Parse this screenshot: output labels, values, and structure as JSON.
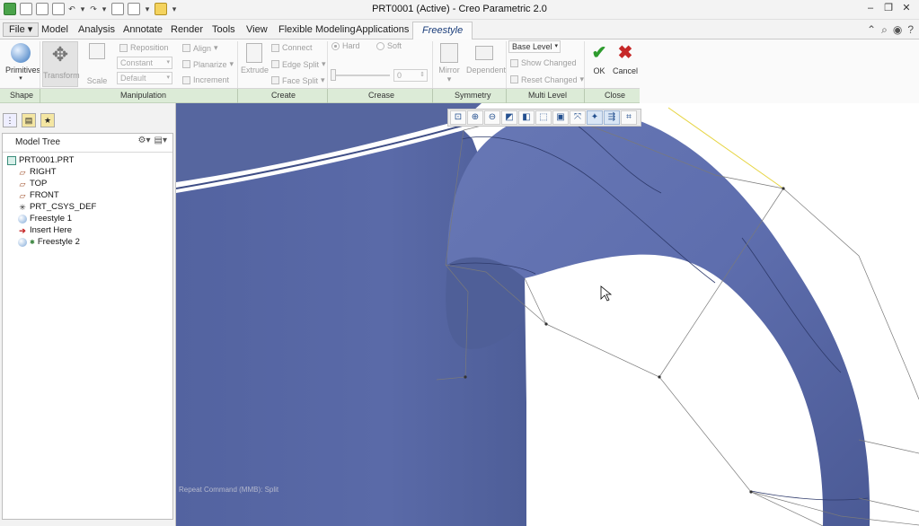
{
  "window": {
    "title": "PRT0001 (Active) - Creo Parametric 2.0",
    "controls": [
      "minimize-icon",
      "restore-icon",
      "close-icon"
    ]
  },
  "quick_access": [
    "app-icon",
    "new-icon",
    "open-icon",
    "save-icon",
    "undo-icon",
    "redo-icon",
    "regenerate-icon",
    "windows-icon",
    "close-window-icon",
    "customize-icon"
  ],
  "menu": {
    "file_label": "File",
    "tabs": [
      "Model",
      "Analysis",
      "Annotate",
      "Render",
      "Tools",
      "View",
      "Flexible Modeling",
      "Applications"
    ],
    "active_tab": "Freestyle"
  },
  "ribbon": {
    "primitives": "Primitives",
    "transform": "Transform",
    "scale": "Scale",
    "reposition": "Reposition",
    "align": "Align",
    "planarize": "Planarize",
    "increment": "Increment",
    "constant": "Constant",
    "default": "Default",
    "extrude": "Extrude",
    "connect": "Connect",
    "edge_split": "Edge Split",
    "face_split": "Face Split",
    "hard": "Hard",
    "soft": "Soft",
    "crease_value": "0",
    "mirror": "Mirror",
    "dependent": "Dependent",
    "base_level": "Base Level",
    "show_changed": "Show Changed",
    "reset_changed": "Reset Changed",
    "ok": "OK",
    "cancel": "Cancel",
    "ok_color": "#2e9b2e",
    "cancel_color": "#c62828"
  },
  "groups": [
    "Shape",
    "Manipulation",
    "Create",
    "Crease",
    "Symmetry",
    "Multi Level",
    "Close"
  ],
  "model_tree": {
    "title": "Model Tree",
    "items": [
      {
        "label": "PRT0001.PRT",
        "icon": "part-icon"
      },
      {
        "label": "RIGHT",
        "icon": "datum-plane-icon"
      },
      {
        "label": "TOP",
        "icon": "datum-plane-icon"
      },
      {
        "label": "FRONT",
        "icon": "datum-plane-icon"
      },
      {
        "label": "PRT_CSYS_DEF",
        "icon": "csys-icon"
      },
      {
        "label": "Freestyle 1",
        "icon": "freestyle-icon"
      },
      {
        "label": "Insert Here",
        "icon": "insert-arrow-icon"
      },
      {
        "label": "Freestyle 2",
        "icon": "freestyle-icon"
      }
    ]
  },
  "viewport": {
    "status": "Repeat Command (MMB): Split",
    "model_color": "#5b6aa8"
  }
}
